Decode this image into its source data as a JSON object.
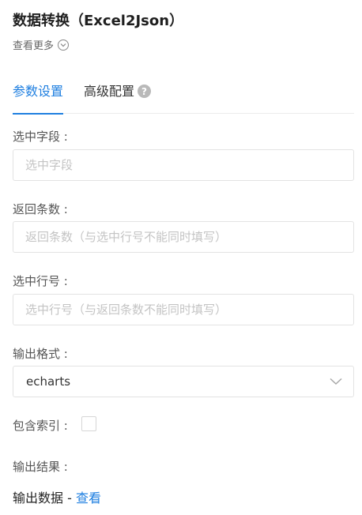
{
  "header": {
    "title": "数据转换（Excel2Json）",
    "more_label": "查看更多"
  },
  "tabs": [
    {
      "label": "参数设置",
      "active": true
    },
    {
      "label": "高级配置",
      "active": false
    }
  ],
  "help_icon": "?",
  "form": {
    "selected_fields": {
      "label": "选中字段 :",
      "placeholder": "选中字段",
      "value": ""
    },
    "return_count": {
      "label": "返回条数 :",
      "placeholder": "返回条数（与选中行号不能同时填写）",
      "value": ""
    },
    "selected_rows": {
      "label": "选中行号 :",
      "placeholder": "选中行号（与返回条数不能同时填写）",
      "value": ""
    },
    "output_format": {
      "label": "输出格式 :",
      "value": "echarts"
    },
    "include_index": {
      "label": "包含索引 :",
      "checked": false
    },
    "output_result": {
      "label": "输出结果 :",
      "text": "输出数据",
      "separator": " - ",
      "link": "查看"
    }
  },
  "colors": {
    "accent": "#1f7fe0",
    "border": "#e3e3e3",
    "placeholder": "#c4c4c4"
  },
  "icons": {
    "more": "chevron-down-circle-icon",
    "help": "question-circle-icon",
    "select": "chevron-down-icon"
  }
}
